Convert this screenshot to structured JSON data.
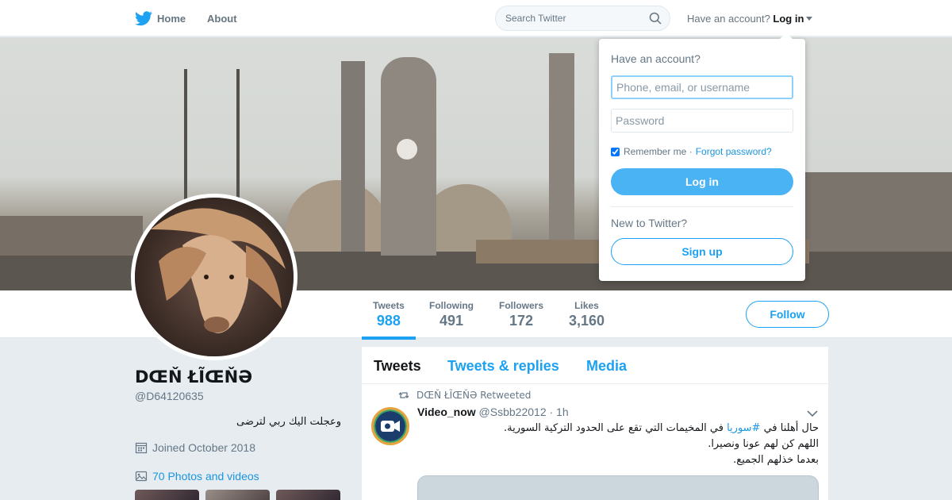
{
  "nav": {
    "home_label": "Home",
    "about_label": "About",
    "search_placeholder": "Search Twitter",
    "have_account_text": "Have an account?",
    "login_label": "Log in"
  },
  "colors": {
    "accent": "#1da1f2",
    "link": "#1b95e0",
    "muted": "#657786",
    "page_bg": "#e6ecf0"
  },
  "icons": {
    "logo": "twitter-bird-icon",
    "search": "search-icon",
    "calendar": "calendar-icon",
    "photo": "photo-icon",
    "retweet": "retweet-icon",
    "caret": "chevron-down-icon"
  },
  "profile": {
    "name": "DŒŇ ŁĨŒŇƏ",
    "handle": "@D64120635",
    "bio": "وعجلت اليك ربي لترضى",
    "joined": "Joined October 2018",
    "photos_link": "70 Photos and videos"
  },
  "stats": [
    {
      "label": "Tweets",
      "value": "988"
    },
    {
      "label": "Following",
      "value": "491"
    },
    {
      "label": "Followers",
      "value": "172"
    },
    {
      "label": "Likes",
      "value": "3,160"
    }
  ],
  "follow_label": "Follow",
  "timeline": {
    "tabs": [
      "Tweets",
      "Tweets & replies",
      "Media"
    ],
    "tweet": {
      "context": "DŒŇ ŁĨŒŇƏ Retweeted",
      "author_name": "Video_now",
      "author_handle": "@Ssbb22012",
      "time": "· 1h",
      "text_line1_pre": "حال أهلنا في ",
      "text_line1_hashtag": "#سوريا",
      "text_line1_post": " في المخيمات التي تقع على الحدود التركية السورية.",
      "text_line2": "اللهم كن لهم عونا ونصيرا.",
      "text_line3": "بعدما خذلهم الجميع."
    }
  },
  "login_dropdown": {
    "title": "Have an account?",
    "username_placeholder": "Phone, email, or username",
    "password_placeholder": "Password",
    "remember_label": "Remember me ·",
    "forgot_label": "Forgot password?",
    "login_button": "Log in",
    "new_text": "New to Twitter?",
    "signup_button": "Sign up"
  }
}
